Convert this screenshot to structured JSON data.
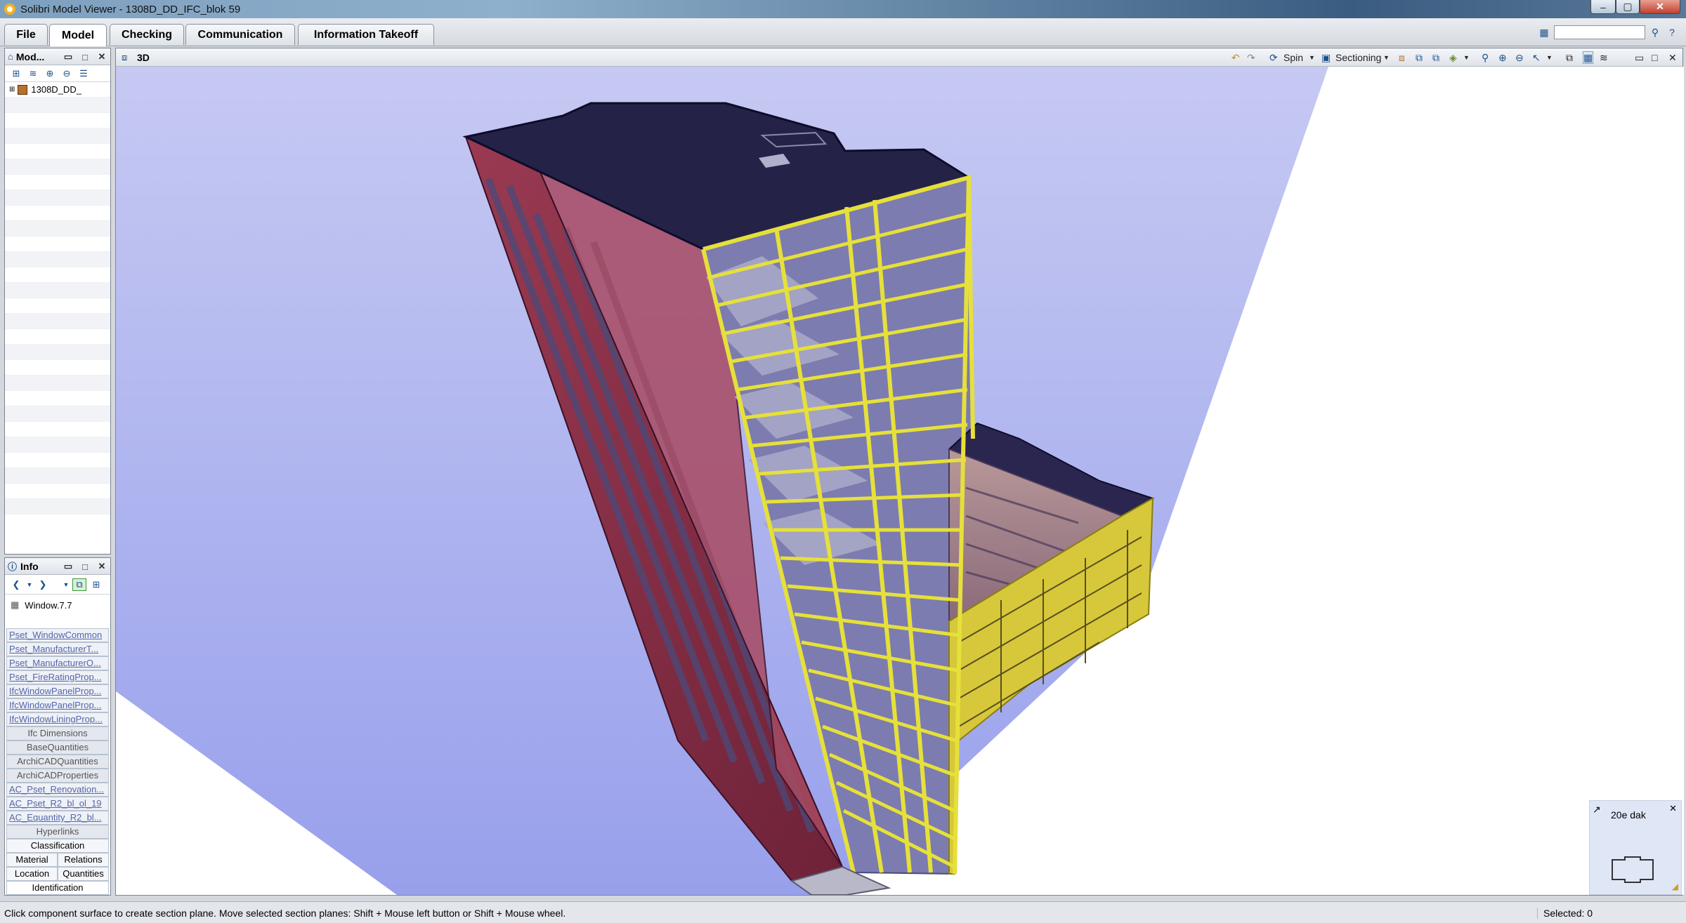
{
  "window": {
    "title": "Solibri Model Viewer - 1308D_DD_IFC_blok 59",
    "minimize": "–",
    "maximize": "▢",
    "close": "✕"
  },
  "menu_tabs": [
    {
      "label": "File"
    },
    {
      "label": "Model"
    },
    {
      "label": "Checking"
    },
    {
      "label": "Communication"
    },
    {
      "label": "Information Takeoff"
    }
  ],
  "model_tree": {
    "title": "Mod...",
    "root_item": "1308D_DD_"
  },
  "info": {
    "title": "Info",
    "selected": "Window.7.7",
    "links": [
      "Pset_WindowCommon",
      "Pset_ManufacturerT...",
      "Pset_ManufacturerO...",
      "Pset_FireRatingProp...",
      "IfcWindowPanelProp...",
      "IfcWindowPanelProp...",
      "IfcWindowLiningProp..."
    ],
    "tabs": [
      "Ifc Dimensions",
      "BaseQuantities",
      "ArchiCADQuantities",
      "ArchiCADProperties",
      "AC_Pset_Renovation...",
      "AC_Pset_R2_bl_ol_19",
      "AC_Equantity_R2_bl...",
      "Hyperlinks"
    ],
    "bottom_tabs": {
      "classification": "Classification",
      "material": "Material",
      "relations": "Relations",
      "location": "Location",
      "quantities": "Quantities",
      "identification": "Identification"
    }
  },
  "viewport": {
    "title": "3D",
    "spin_label": "Spin",
    "sectioning_label": "Sectioning"
  },
  "floor": {
    "label": "20e dak"
  },
  "status": {
    "message": "Click component surface to create section plane. Move selected section planes: Shift + Mouse left button or Shift + Mouse wheel.",
    "selected": "Selected: 0"
  },
  "colors": {
    "sky_top": "#c6c9f2",
    "sky_bottom": "#9aa2ee",
    "roof": "#252248",
    "facade": "#8a3048",
    "section_highlight": "#e6e03a",
    "floor_slab": "#9898c0"
  }
}
